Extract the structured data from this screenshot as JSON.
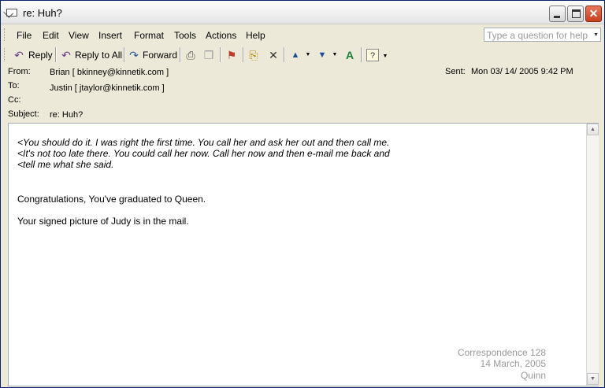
{
  "window": {
    "title": "re: Huh?"
  },
  "menu": {
    "items": [
      "File",
      "Edit",
      "View",
      "Insert",
      "Format",
      "Tools",
      "Actions",
      "Help"
    ],
    "help_placeholder": "Type a question for help"
  },
  "toolbar": {
    "reply_label": "Reply",
    "reply_all_label": "Reply to All",
    "forward_label": "Forward",
    "icons": [
      "reply-icon",
      "reply-all-icon",
      "forward-icon",
      "print-icon",
      "copy-icon",
      "flag-icon",
      "move-to-folder-icon",
      "delete-icon",
      "previous-item-icon",
      "next-item-icon",
      "address-book-icon",
      "help-icon"
    ]
  },
  "header": {
    "from_label": "From:",
    "from_value": "Brian [ bkinney@kinnetik.com ]",
    "to_label": "To:",
    "to_value": "Justin [ jtaylor@kinnetik.com ]",
    "cc_label": "Cc:",
    "cc_value": "",
    "subject_label": "Subject:",
    "subject_value": "re: Huh?",
    "sent_label": "Sent:",
    "sent_value": "Mon 03/ 14/ 2005  9:42 PM"
  },
  "body": {
    "quoted_lines": [
      "<You should do it. I was right the first time. You call her and ask her out and then call me.",
      "<It's not too late there. You could call her now. Call her now and then e-mail me back and",
      "<tell me what she said."
    ],
    "paragraphs": [
      "Congratulations, You've graduated to Queen.",
      "Your signed picture of Judy is in the mail."
    ],
    "signature": [
      "Correspondence 128",
      "14 March, 2005",
      "Quinn"
    ]
  },
  "colors": {
    "window_bg": "#ece9d8",
    "border": "#0a246a",
    "signature": "#9a9a9a",
    "close_button": "#c6401f"
  }
}
